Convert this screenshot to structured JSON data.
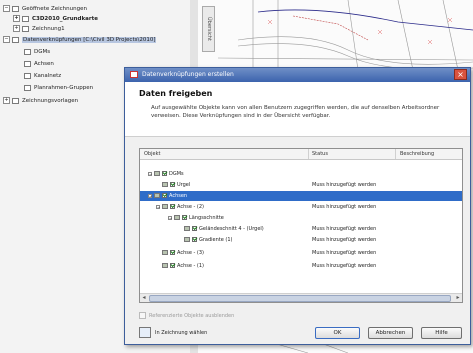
{
  "tree": {
    "items": [
      {
        "label": "Geöffnete Zeichnungen",
        "bold": false,
        "selected": false
      },
      {
        "label": "C3D2010_Grundkarte",
        "bold": true,
        "selected": false
      },
      {
        "label": "Zeichnung1",
        "bold": false,
        "selected": false
      },
      {
        "label": "Datenverknüpfungen [C:\\Civil 3D Projects\\2010]",
        "bold": false,
        "selected": true
      },
      {
        "label": "DGMs",
        "bold": false,
        "selected": false
      },
      {
        "label": "Achsen",
        "bold": false,
        "selected": false
      },
      {
        "label": "Kanalnetz",
        "bold": false,
        "selected": false
      },
      {
        "label": "Planrahmen-Gruppen",
        "bold": false,
        "selected": false
      },
      {
        "label": "Zeichnungsvorlagen",
        "bold": false,
        "selected": false
      }
    ],
    "side_text": "Übersicht"
  },
  "drawing": {
    "tab_label": "Übersicht"
  },
  "dialog": {
    "title": "Datenverknüpfungen erstellen",
    "heading": "Daten freigeben",
    "description": "Auf ausgewählte Objekte kann von allen Benutzern zugegriffen werden, die auf denselben Arbeitsordner verweisen. Diese Verknüpfungen sind in der Übersicht verfügbar.",
    "columns": {
      "object": "Objekt",
      "status": "Status",
      "description": "Beschreibung"
    },
    "rows": [
      {
        "name": "DGMs",
        "status": "",
        "selected": false
      },
      {
        "name": "Urgel",
        "status": "Muss hinzugefügt werden",
        "selected": false
      },
      {
        "name": "Achsen",
        "status": "",
        "selected": true
      },
      {
        "name": "Achse - (2)",
        "status": "Muss hinzugefügt werden",
        "selected": false
      },
      {
        "name": "Längsschnitte",
        "status": "",
        "selected": false
      },
      {
        "name": "Geländeschnitt 4 - (Urgel)",
        "status": "Muss hinzugefügt werden",
        "selected": false
      },
      {
        "name": "Gradiente (1)",
        "status": "Muss hinzugefügt werden",
        "selected": false
      },
      {
        "name": "Achse - (3)",
        "status": "Muss hinzugefügt werden",
        "selected": false
      },
      {
        "name": "Achse - (1)",
        "status": "Muss hinzugefügt werden",
        "selected": false
      }
    ],
    "hide_option": "Referenzierte Objekte ausblenden",
    "view_in_drawing": "In Zeichnung wählen",
    "ok_label": "OK",
    "cancel_label": "Abbrechen",
    "help_label": "Hilfe"
  },
  "colors": {
    "titlebar": "#3c63ad",
    "selection": "#2f6cc8",
    "tree_selection": "#b7c6e0"
  }
}
